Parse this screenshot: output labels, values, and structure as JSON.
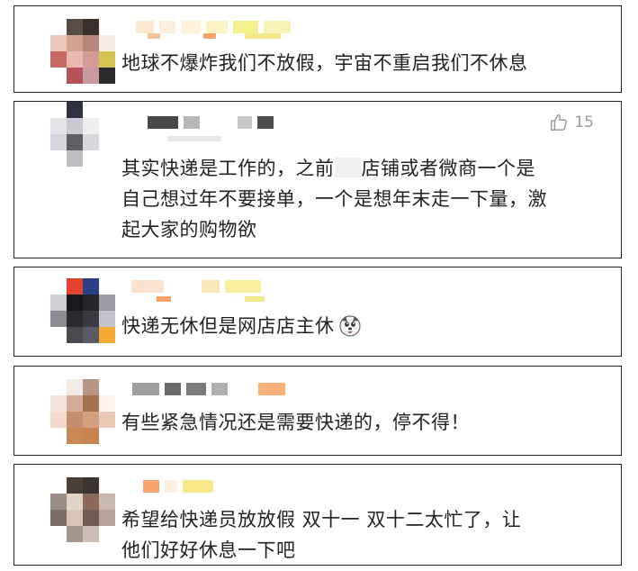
{
  "comments": [
    {
      "text_lines": [
        "地球不爆炸我们不放假，宇宙不重启我们不休息"
      ],
      "likes": null
    },
    {
      "text_lines": [
        "其实快递是工作的，之前",
        "店铺或者微商一个是",
        "自己想过年不要接单，一个是想年末走一下量，激",
        "起大家的购物欲"
      ],
      "likes": "15"
    },
    {
      "text_lines": [
        "快递无休但是网店店主休"
      ],
      "likes": null
    },
    {
      "text_lines": [
        "有些紧急情况还是需要快递的，停不得！"
      ],
      "likes": null
    },
    {
      "text_lines": [
        "希望给快递员放放假  双十一  双十二太忙了，让",
        "他们好好休息一下吧"
      ],
      "likes": null
    }
  ],
  "icons": {
    "like": "thumbs-up-icon",
    "emoji": "dog-emoji-icon"
  },
  "colors": {
    "border": "#222222",
    "text": "#222222",
    "like_text": "#9a9a9a",
    "blur_orange": "#f7a36a",
    "blur_yellow": "#f6ee9a",
    "blur_gray": "#555555"
  }
}
